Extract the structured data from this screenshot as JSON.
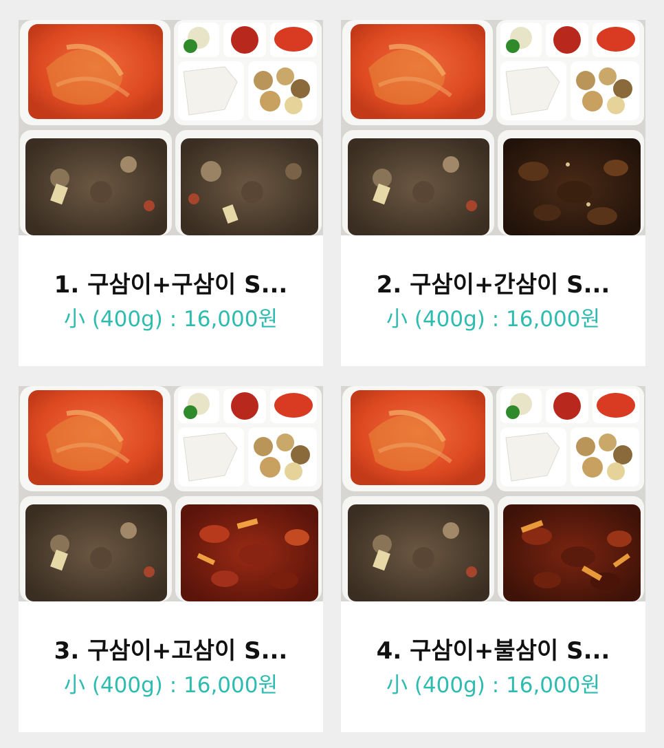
{
  "colors": {
    "background": "#eeeeee",
    "card": "#ffffff",
    "title": "#111111",
    "price": "#2fbcb0"
  },
  "products": [
    {
      "title": "1. 구삼이+구삼이 S...",
      "price": "小 (400g) : 16,000원",
      "image": "lunchbox-photo-grilled-grilled"
    },
    {
      "title": "2. 구삼이+간삼이 S...",
      "price": "小 (400g) : 16,000원",
      "image": "lunchbox-photo-grilled-soy"
    },
    {
      "title": "3. 구삼이+고삼이 S...",
      "price": "小 (400g) : 16,000원",
      "image": "lunchbox-photo-grilled-gochujang"
    },
    {
      "title": "4. 구삼이+불삼이 S...",
      "price": "小 (400g) : 16,000원",
      "image": "lunchbox-photo-grilled-spicy"
    }
  ]
}
